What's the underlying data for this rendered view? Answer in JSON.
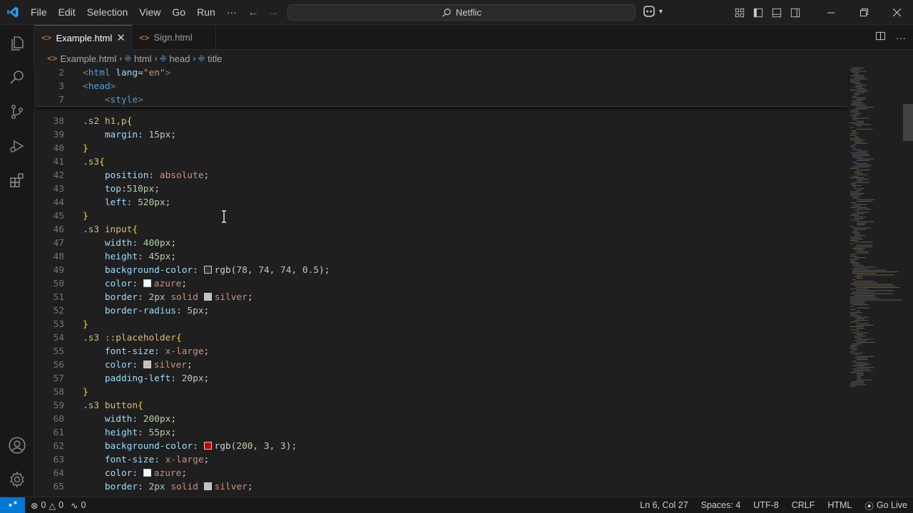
{
  "titlebar": {
    "menu": [
      "File",
      "Edit",
      "Selection",
      "View",
      "Go",
      "Run",
      "···"
    ],
    "search_text": "Netflic"
  },
  "tabs": [
    {
      "label": "Example.html",
      "active": true
    },
    {
      "label": "Sign.html",
      "active": false
    }
  ],
  "breadcrumb": [
    "Example.html",
    "html",
    "head",
    "title"
  ],
  "sticky_lines": [
    {
      "n": "2",
      "indent": "",
      "segments": [
        [
          "t-tag",
          "<"
        ],
        [
          "t-tagname",
          "html"
        ],
        [
          "t-punc",
          " "
        ],
        [
          "t-attr",
          "lang"
        ],
        [
          "t-punc",
          "="
        ],
        [
          "t-str",
          "\"en\""
        ],
        [
          "t-tag",
          ">"
        ]
      ]
    },
    {
      "n": "3",
      "indent": "",
      "segments": [
        [
          "t-tag",
          "<"
        ],
        [
          "t-tagname",
          "head"
        ],
        [
          "t-tag",
          ">"
        ]
      ]
    },
    {
      "n": "7",
      "indent": "    ",
      "segments": [
        [
          "t-tag",
          "<"
        ],
        [
          "t-tagname",
          "style"
        ],
        [
          "t-tag",
          ">"
        ]
      ]
    }
  ],
  "lines": [
    {
      "n": "38",
      "indent": "",
      "segments": [
        [
          "t-sel",
          ".s2 h1,p"
        ],
        [
          "t-brace",
          "{"
        ]
      ]
    },
    {
      "n": "39",
      "indent": "    ",
      "segments": [
        [
          "t-prop",
          "margin"
        ],
        [
          "t-punc",
          ": "
        ],
        [
          "t-num",
          "15px"
        ],
        [
          "t-punc",
          ";"
        ]
      ]
    },
    {
      "n": "40",
      "indent": "",
      "segments": [
        [
          "t-brace",
          "}"
        ]
      ]
    },
    {
      "n": "41",
      "indent": "",
      "segments": [
        [
          "t-sel",
          ".s3"
        ],
        [
          "t-brace",
          "{"
        ]
      ]
    },
    {
      "n": "42",
      "indent": "    ",
      "segments": [
        [
          "t-prop",
          "position"
        ],
        [
          "t-punc",
          ": "
        ],
        [
          "t-val",
          "absolute"
        ],
        [
          "t-punc",
          ";"
        ]
      ]
    },
    {
      "n": "43",
      "indent": "    ",
      "segments": [
        [
          "t-prop",
          "top"
        ],
        [
          "t-punc",
          ":"
        ],
        [
          "t-num",
          "510px"
        ],
        [
          "t-punc",
          ";"
        ]
      ]
    },
    {
      "n": "44",
      "indent": "    ",
      "segments": [
        [
          "t-prop",
          "left"
        ],
        [
          "t-punc",
          ": "
        ],
        [
          "t-num",
          "520px"
        ],
        [
          "t-punc",
          ";"
        ]
      ]
    },
    {
      "n": "45",
      "indent": "",
      "segments": [
        [
          "t-brace",
          "}"
        ]
      ]
    },
    {
      "n": "46",
      "indent": "",
      "segments": [
        [
          "t-sel",
          ".s3 input"
        ],
        [
          "t-brace",
          "{"
        ]
      ]
    },
    {
      "n": "47",
      "indent": "    ",
      "segments": [
        [
          "t-prop",
          "width"
        ],
        [
          "t-punc",
          ": "
        ],
        [
          "t-num",
          "400px"
        ],
        [
          "t-punc",
          ";"
        ]
      ]
    },
    {
      "n": "48",
      "indent": "    ",
      "segments": [
        [
          "t-prop",
          "height"
        ],
        [
          "t-punc",
          ": "
        ],
        [
          "t-num",
          "45px"
        ],
        [
          "t-punc",
          ";"
        ]
      ]
    },
    {
      "n": "49",
      "indent": "    ",
      "segments": [
        [
          "t-prop",
          "background-color"
        ],
        [
          "t-punc",
          ": "
        ],
        [
          "swatch",
          "#4e4a4a80"
        ],
        [
          "t-punc",
          "rgb("
        ],
        [
          "t-num",
          "78"
        ],
        [
          "t-punc",
          ", "
        ],
        [
          "t-num",
          "74"
        ],
        [
          "t-punc",
          ", "
        ],
        [
          "t-num",
          "74"
        ],
        [
          "t-punc",
          ", "
        ],
        [
          "t-num",
          "0.5"
        ],
        [
          "t-punc",
          ");"
        ]
      ]
    },
    {
      "n": "50",
      "indent": "    ",
      "segments": [
        [
          "t-prop",
          "color"
        ],
        [
          "t-punc",
          ": "
        ],
        [
          "swatch",
          "#f0ffff"
        ],
        [
          "t-val",
          "azure"
        ],
        [
          "t-punc",
          ";"
        ]
      ]
    },
    {
      "n": "51",
      "indent": "    ",
      "segments": [
        [
          "t-prop",
          "border"
        ],
        [
          "t-punc",
          ": "
        ],
        [
          "t-num",
          "2px"
        ],
        [
          "t-punc",
          " "
        ],
        [
          "t-val",
          "solid"
        ],
        [
          "t-punc",
          " "
        ],
        [
          "swatch",
          "#c0c0c0"
        ],
        [
          "t-val",
          "silver"
        ],
        [
          "t-punc",
          ";"
        ]
      ]
    },
    {
      "n": "52",
      "indent": "    ",
      "segments": [
        [
          "t-prop",
          "border-radius"
        ],
        [
          "t-punc",
          ": "
        ],
        [
          "t-num",
          "5px"
        ],
        [
          "t-punc",
          ";"
        ]
      ]
    },
    {
      "n": "53",
      "indent": "",
      "segments": [
        [
          "t-brace",
          "}"
        ]
      ]
    },
    {
      "n": "54",
      "indent": "",
      "segments": [
        [
          "t-sel",
          ".s3 ::placeholder"
        ],
        [
          "t-brace",
          "{"
        ]
      ]
    },
    {
      "n": "55",
      "indent": "    ",
      "segments": [
        [
          "t-prop",
          "font-size"
        ],
        [
          "t-punc",
          ": "
        ],
        [
          "t-val",
          "x-large"
        ],
        [
          "t-punc",
          ";"
        ]
      ]
    },
    {
      "n": "56",
      "indent": "    ",
      "segments": [
        [
          "t-prop",
          "color"
        ],
        [
          "t-punc",
          ": "
        ],
        [
          "swatch",
          "#c0c0c0"
        ],
        [
          "t-val",
          "silver"
        ],
        [
          "t-punc",
          ";"
        ]
      ]
    },
    {
      "n": "57",
      "indent": "    ",
      "segments": [
        [
          "t-prop",
          "padding-left"
        ],
        [
          "t-punc",
          ": "
        ],
        [
          "t-num",
          "20px"
        ],
        [
          "t-punc",
          ";"
        ]
      ]
    },
    {
      "n": "58",
      "indent": "",
      "segments": [
        [
          "t-brace",
          "}"
        ]
      ]
    },
    {
      "n": "59",
      "indent": "",
      "segments": [
        [
          "t-sel",
          ".s3 button"
        ],
        [
          "t-brace",
          "{"
        ]
      ]
    },
    {
      "n": "60",
      "indent": "    ",
      "segments": [
        [
          "t-prop",
          "width"
        ],
        [
          "t-punc",
          ": "
        ],
        [
          "t-num",
          "200px"
        ],
        [
          "t-punc",
          ";"
        ]
      ]
    },
    {
      "n": "61",
      "indent": "    ",
      "segments": [
        [
          "t-prop",
          "height"
        ],
        [
          "t-punc",
          ": "
        ],
        [
          "t-num",
          "55px"
        ],
        [
          "t-punc",
          ";"
        ]
      ]
    },
    {
      "n": "62",
      "indent": "    ",
      "segments": [
        [
          "t-prop",
          "background-color"
        ],
        [
          "t-punc",
          ": "
        ],
        [
          "swatch",
          "#c80303"
        ],
        [
          "t-punc",
          "rgb("
        ],
        [
          "t-num",
          "200"
        ],
        [
          "t-punc",
          ", "
        ],
        [
          "t-num",
          "3"
        ],
        [
          "t-punc",
          ", "
        ],
        [
          "t-num",
          "3"
        ],
        [
          "t-punc",
          ");"
        ]
      ]
    },
    {
      "n": "63",
      "indent": "    ",
      "segments": [
        [
          "t-prop",
          "font-size"
        ],
        [
          "t-punc",
          ": "
        ],
        [
          "t-val",
          "x-large"
        ],
        [
          "t-punc",
          ";"
        ]
      ]
    },
    {
      "n": "64",
      "indent": "    ",
      "segments": [
        [
          "t-prop",
          "color"
        ],
        [
          "t-punc",
          ": "
        ],
        [
          "swatch",
          "#f0ffff"
        ],
        [
          "t-val",
          "azure"
        ],
        [
          "t-punc",
          ";"
        ]
      ]
    },
    {
      "n": "65",
      "indent": "    ",
      "segments": [
        [
          "t-prop",
          "border"
        ],
        [
          "t-punc",
          ": "
        ],
        [
          "t-num",
          "2px"
        ],
        [
          "t-punc",
          " "
        ],
        [
          "t-val",
          "solid"
        ],
        [
          "t-punc",
          " "
        ],
        [
          "swatch",
          "#c0c0c0"
        ],
        [
          "t-val",
          "silver"
        ],
        [
          "t-punc",
          ";"
        ]
      ]
    }
  ],
  "statusbar": {
    "errors": "0",
    "warnings": "0",
    "ports": "0",
    "position": "Ln 6, Col 27",
    "spaces": "Spaces: 4",
    "encoding": "UTF-8",
    "eol": "CRLF",
    "language": "HTML",
    "golive": "Go Live"
  },
  "colors": {
    "accent": "#0078d4",
    "background": "#1f1f1f"
  }
}
